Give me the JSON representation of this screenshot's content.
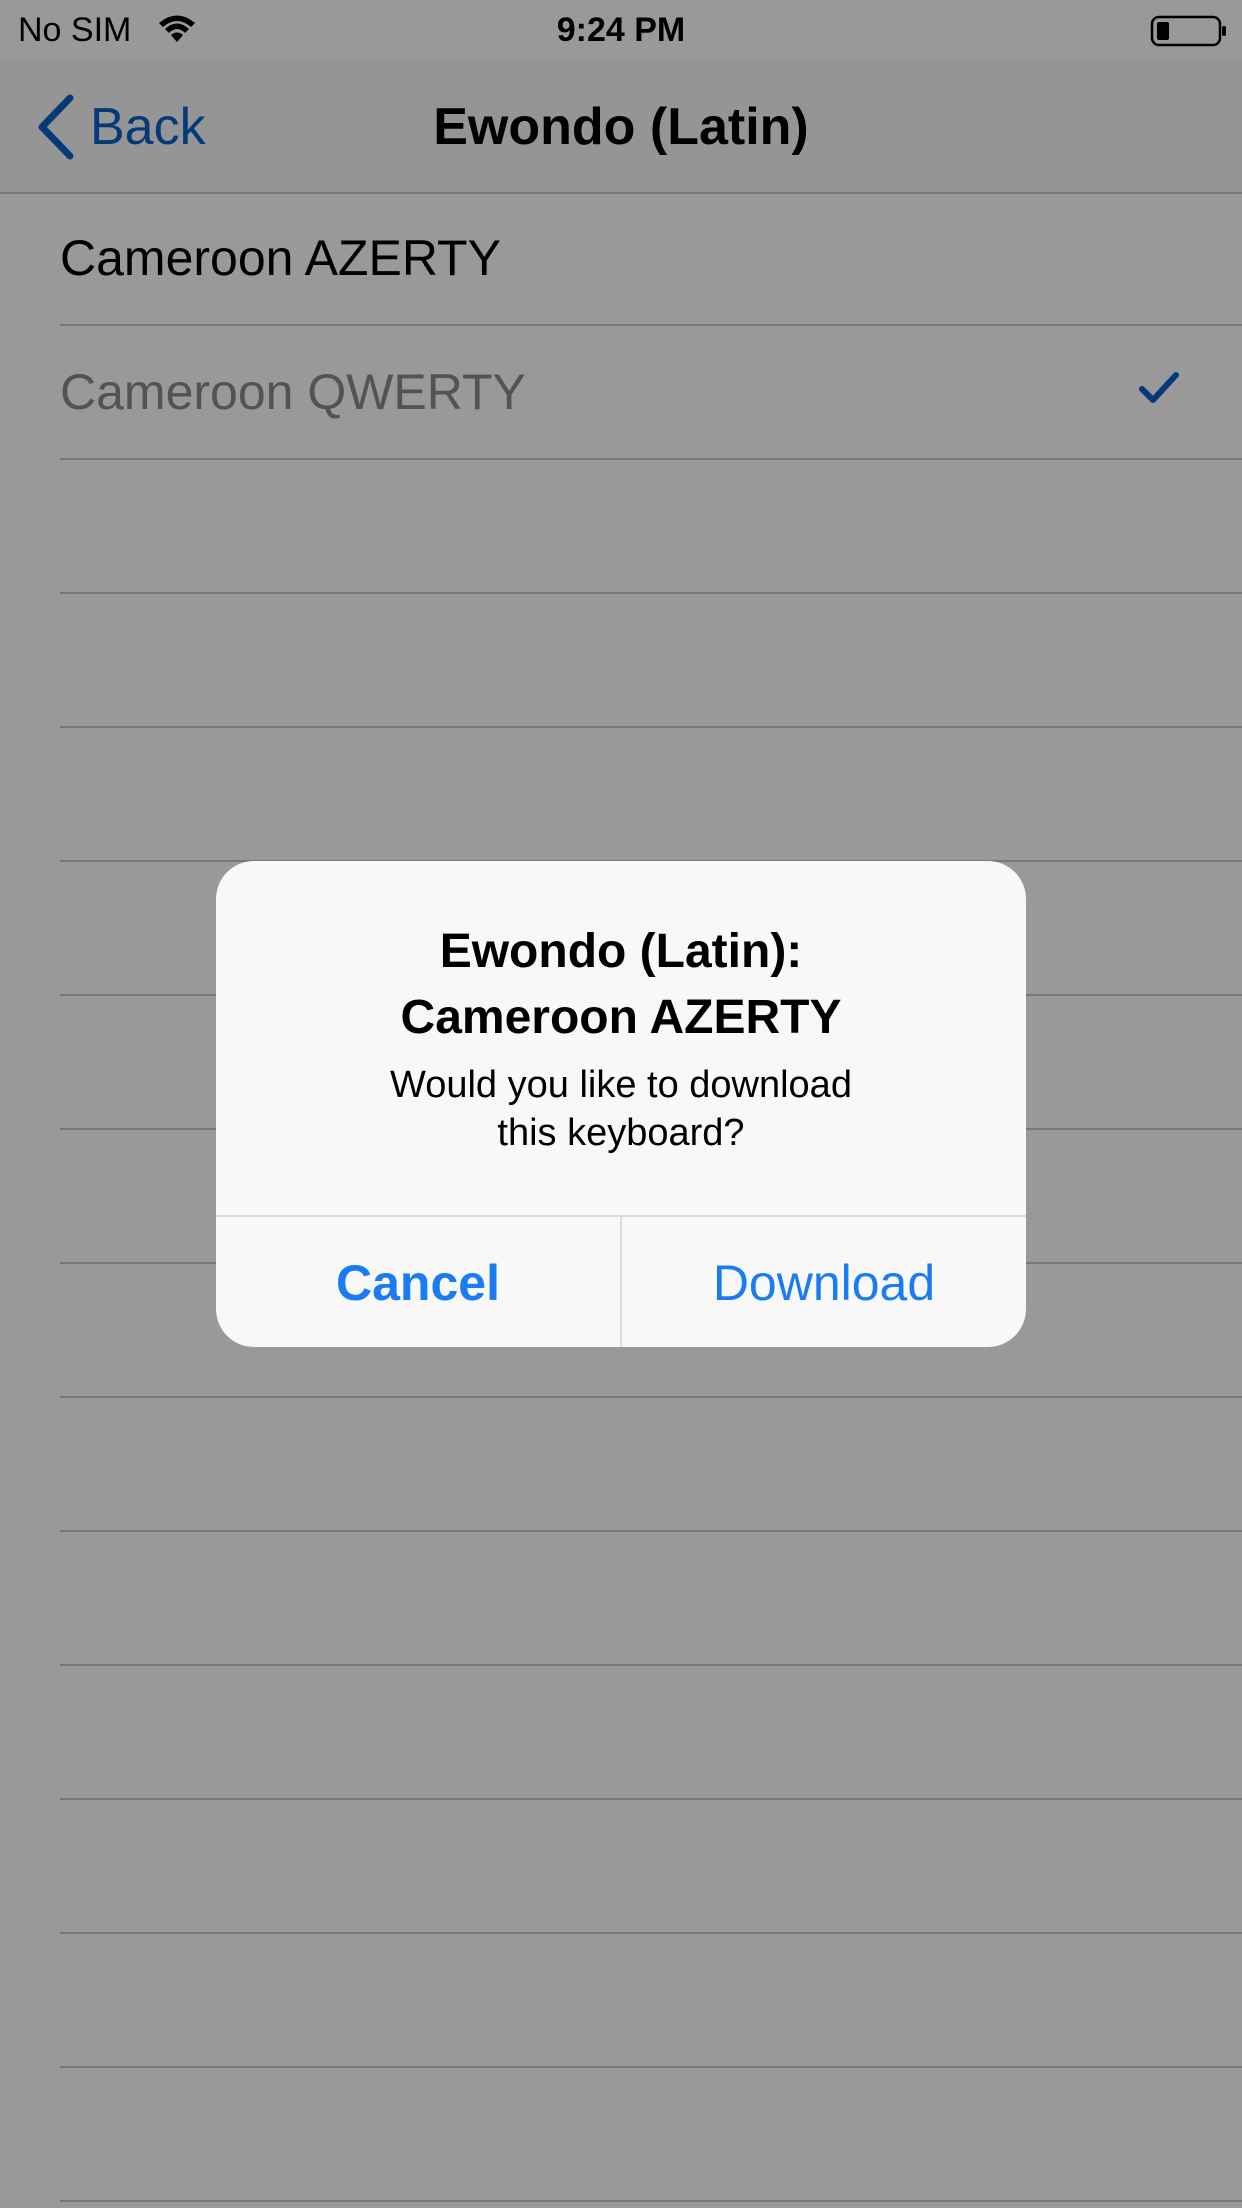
{
  "status_bar": {
    "carrier": "No SIM",
    "time": "9:24 PM",
    "wifi_icon": "wifi-icon",
    "battery_icon": "battery-icon"
  },
  "nav": {
    "back_label": "Back",
    "back_icon": "chevron-left-icon",
    "title": "Ewondo (Latin)"
  },
  "list": {
    "items": [
      {
        "label": "Cameroon AZERTY",
        "selected": false
      },
      {
        "label": "Cameroon QWERTY",
        "selected": true
      }
    ],
    "empty_rows": 13
  },
  "alert": {
    "title": "Ewondo (Latin):\nCameroon AZERTY",
    "title_line1": "Ewondo (Latin):",
    "title_line2": "Cameroon AZERTY",
    "message_line1": "Would you like to download",
    "message_line2": "this keyboard?",
    "cancel_label": "Cancel",
    "download_label": "Download"
  },
  "colors": {
    "accent": "#0a60c8",
    "alert_button": "#1a7cf0",
    "dim_overlay": "rgba(0,0,0,0.4)"
  }
}
